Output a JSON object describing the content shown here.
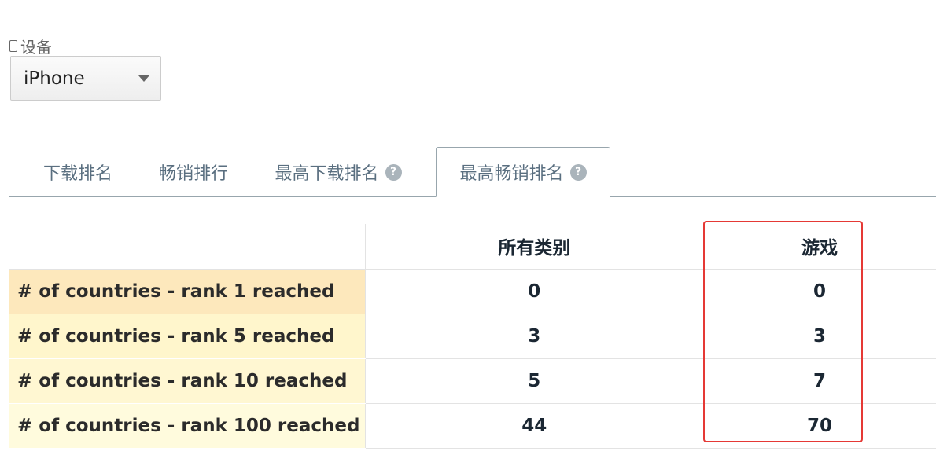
{
  "device": {
    "label": "设备",
    "icon": "phone-icon",
    "selected": "iPhone"
  },
  "tabs": [
    {
      "label": "下载排名",
      "help": false
    },
    {
      "label": "畅销排行",
      "help": false
    },
    {
      "label": "最高下载排名",
      "help": true
    },
    {
      "label": "最高畅销排名",
      "help": true,
      "active": true
    }
  ],
  "table": {
    "columns": [
      "所有类别",
      "游戏"
    ],
    "rows": [
      {
        "label": "# of countries - rank 1 reached",
        "values": [
          "0",
          "0"
        ]
      },
      {
        "label": "# of countries - rank 5 reached",
        "values": [
          "3",
          "3"
        ]
      },
      {
        "label": "# of countries - rank 10 reached",
        "values": [
          "5",
          "7"
        ]
      },
      {
        "label": "# of countries - rank 100 reached",
        "values": [
          "44",
          "70"
        ]
      }
    ],
    "highlight_color": "#e53935"
  }
}
